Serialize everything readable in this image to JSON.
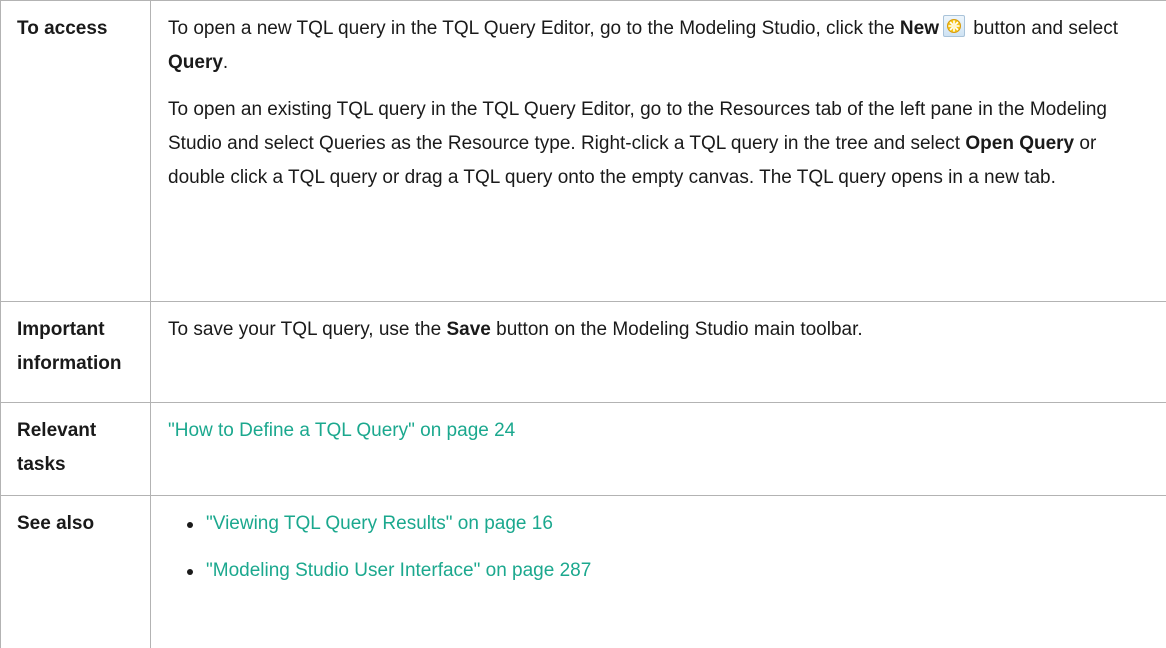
{
  "rows": {
    "access": {
      "label": "To access",
      "p1": {
        "before_new": "To open a new TQL query in the TQL Query Editor, go to the Modeling Studio, click the ",
        "new_label": "New",
        "after_new": " button and select ",
        "query_label": "Query",
        "end": "."
      },
      "p2": {
        "before_open": "To open an existing TQL query in the TQL Query Editor, go to the Resources tab of the left pane in the Modeling Studio and select Queries as the Resource type. Right-click a TQL query in the tree and select ",
        "open_label": "Open Query",
        "after_open": " or double click a TQL query or drag a TQL query onto the empty canvas. The TQL query opens in a new tab."
      },
      "new_icon": "new-star-icon"
    },
    "important": {
      "label": "Important information",
      "before_save": "To save your TQL query, use the ",
      "save_label": "Save",
      "after_save": " button on the Modeling Studio main toolbar."
    },
    "relevant": {
      "label": "Relevant tasks",
      "link": "\"How to Define a TQL Query\" on page 24"
    },
    "see_also": {
      "label": "See also",
      "links": [
        "\"Viewing TQL Query Results\" on page 16",
        "\"Modeling Studio User Interface\" on page 287"
      ]
    }
  },
  "colors": {
    "link": "#1ba88e",
    "border": "#b3b3b3",
    "text": "#1a1a1a"
  }
}
